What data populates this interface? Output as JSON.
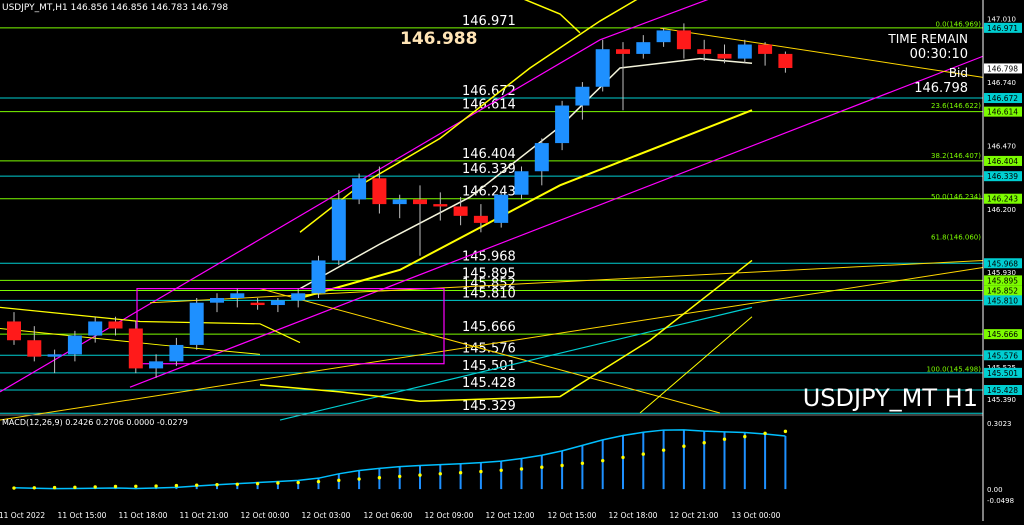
{
  "header": {
    "symbol_tf": "USDJPY_MT,H1",
    "ohlc": "146.856 146.856 146.783 146.798"
  },
  "overlay": {
    "current_price_big": "146.988",
    "time_remain_label": "TIME REMAIN",
    "time_remain_value": "00:30:10",
    "bid_label": "Bid",
    "bid_value": "146.798",
    "watermark": "USDJPY_MT H1"
  },
  "colors": {
    "background": "#000000",
    "bull": "#1e90ff",
    "bear": "#ff1a1a",
    "level_green": "#7cfc00",
    "level_cyan": "#00ced1",
    "magenta": "#ff00ff",
    "yellow": "#ffff00",
    "axis_text": "#ffffff",
    "macd_line": "#00bfff",
    "macd_signal": "#ffff00",
    "macd_hist": "#1e90ff"
  },
  "chart_data": {
    "type": "candlestick",
    "timeframe": "H1",
    "symbol": "USDJPY_MT",
    "ylim": [
      145.33,
      147.03
    ],
    "y_ticks": [
      "147.010",
      "146.740",
      "146.470",
      "146.200",
      "145.930",
      "145.525",
      "145.390"
    ],
    "price_tags": [
      {
        "value": "146.971",
        "color": "#00ced1"
      },
      {
        "value": "146.798",
        "color": "#ffffff"
      },
      {
        "value": "146.672",
        "color": "#00ced1"
      },
      {
        "value": "146.614",
        "color": "#7cfc00"
      },
      {
        "value": "146.404",
        "color": "#7cfc00"
      },
      {
        "value": "146.339",
        "color": "#00ced1"
      },
      {
        "value": "146.243",
        "color": "#7cfc00"
      },
      {
        "value": "145.968",
        "color": "#00ced1"
      },
      {
        "value": "145.895",
        "color": "#7cfc00"
      },
      {
        "value": "145.852",
        "color": "#7cfc00"
      },
      {
        "value": "145.810",
        "color": "#00ced1"
      },
      {
        "value": "145.666",
        "color": "#7cfc00"
      },
      {
        "value": "145.576",
        "color": "#00ced1"
      },
      {
        "value": "145.501",
        "color": "#00ced1"
      },
      {
        "value": "145.428",
        "color": "#00ced1"
      }
    ],
    "levels": [
      {
        "value": 146.971,
        "label": "146.971",
        "color": "#7cfc00"
      },
      {
        "value": 146.672,
        "label": "146.672",
        "color": "#00ced1"
      },
      {
        "value": 146.614,
        "label": "146.614",
        "color": "#7cfc00"
      },
      {
        "value": 146.404,
        "label": "146.404",
        "color": "#7cfc00"
      },
      {
        "value": 146.339,
        "label": "146.339",
        "color": "#00ced1"
      },
      {
        "value": 146.243,
        "label": "146.243",
        "color": "#7cfc00"
      },
      {
        "value": 145.968,
        "label": "145.968",
        "color": "#00ced1"
      },
      {
        "value": 145.895,
        "label": "145.895",
        "color": "#7cfc00"
      },
      {
        "value": 145.852,
        "label": "145.852",
        "color": "#7cfc00"
      },
      {
        "value": 145.81,
        "label": "145.810",
        "color": "#00ced1"
      },
      {
        "value": 145.666,
        "label": "145.666",
        "color": "#7cfc00"
      },
      {
        "value": 145.576,
        "label": "145.576",
        "color": "#00ced1"
      },
      {
        "value": 145.501,
        "label": "145.501",
        "color": "#00ced1"
      },
      {
        "value": 145.428,
        "label": "145.428",
        "color": "#00ced1"
      },
      {
        "value": 145.329,
        "label": "145.329",
        "color": "#00ced1"
      }
    ],
    "fibonacci": [
      {
        "value": 146.969,
        "label": "0.0(146.969)"
      },
      {
        "value": 146.622,
        "label": "23.6(146.622)"
      },
      {
        "value": 146.407,
        "label": "38.2(146.407)"
      },
      {
        "value": 146.234,
        "label": "50.0(146.234)"
      },
      {
        "value": 146.06,
        "label": "61.8(146.060)"
      },
      {
        "value": 145.498,
        "label": "100.0(145.498)"
      }
    ],
    "x_ticks": [
      "11 Oct 2022",
      "11 Oct 15:00",
      "11 Oct 18:00",
      "11 Oct 21:00",
      "12 Oct 00:00",
      "12 Oct 03:00",
      "12 Oct 06:00",
      "12 Oct 09:00",
      "12 Oct 12:00",
      "12 Oct 15:00",
      "12 Oct 18:00",
      "12 Oct 21:00",
      "13 Oct 00:00"
    ],
    "candles": [
      [
        145.72,
        145.76,
        145.62,
        145.64
      ],
      [
        145.64,
        145.7,
        145.55,
        145.57
      ],
      [
        145.57,
        145.6,
        145.5,
        145.58
      ],
      [
        145.58,
        145.68,
        145.55,
        145.66
      ],
      [
        145.66,
        145.74,
        145.63,
        145.72
      ],
      [
        145.72,
        145.74,
        145.66,
        145.69
      ],
      [
        145.69,
        145.72,
        145.5,
        145.52
      ],
      [
        145.52,
        145.58,
        145.48,
        145.55
      ],
      [
        145.55,
        145.65,
        145.53,
        145.62
      ],
      [
        145.62,
        145.82,
        145.6,
        145.8
      ],
      [
        145.8,
        145.84,
        145.76,
        145.82
      ],
      [
        145.82,
        145.86,
        145.78,
        145.84
      ],
      [
        145.8,
        145.82,
        145.77,
        145.79
      ],
      [
        145.79,
        145.82,
        145.76,
        145.81
      ],
      [
        145.81,
        145.86,
        145.78,
        145.84
      ],
      [
        145.84,
        146.0,
        145.82,
        145.98
      ],
      [
        145.98,
        146.28,
        145.96,
        146.24
      ],
      [
        146.24,
        146.35,
        146.22,
        146.33
      ],
      [
        146.33,
        146.38,
        146.18,
        146.22
      ],
      [
        146.22,
        146.26,
        146.16,
        146.24
      ],
      [
        146.24,
        146.3,
        146.0,
        146.22
      ],
      [
        146.22,
        146.27,
        146.15,
        146.21
      ],
      [
        146.21,
        146.25,
        146.13,
        146.17
      ],
      [
        146.17,
        146.22,
        146.1,
        146.14
      ],
      [
        146.14,
        146.28,
        146.12,
        146.26
      ],
      [
        146.26,
        146.38,
        146.24,
        146.36
      ],
      [
        146.36,
        146.5,
        146.3,
        146.48
      ],
      [
        146.48,
        146.66,
        146.45,
        146.64
      ],
      [
        146.64,
        146.74,
        146.58,
        146.72
      ],
      [
        146.72,
        146.92,
        146.7,
        146.88
      ],
      [
        146.88,
        146.91,
        146.62,
        146.86
      ],
      [
        146.86,
        146.94,
        146.84,
        146.91
      ],
      [
        146.91,
        146.97,
        146.89,
        146.96
      ],
      [
        146.96,
        146.99,
        146.84,
        146.88
      ],
      [
        146.88,
        146.92,
        146.83,
        146.86
      ],
      [
        146.86,
        146.9,
        146.82,
        146.84
      ],
      [
        146.84,
        146.92,
        146.82,
        146.9
      ],
      [
        146.9,
        146.91,
        146.81,
        146.86
      ],
      [
        146.86,
        146.87,
        146.78,
        146.8
      ]
    ],
    "macd": {
      "label": "MACD(12,26,9) 0.2426 0.2706 0.0000 -0.0279",
      "ylim": [
        -0.0498,
        0.3023
      ],
      "y_ticks": [
        "0.3023",
        "0.00",
        "-0.0498"
      ],
      "main": [
        0.006,
        0.004,
        0.002,
        0.003,
        0.004,
        0.005,
        0.003,
        0.005,
        0.008,
        0.014,
        0.02,
        0.025,
        0.03,
        0.035,
        0.04,
        0.05,
        0.07,
        0.085,
        0.095,
        0.103,
        0.108,
        0.112,
        0.116,
        0.121,
        0.128,
        0.14,
        0.155,
        0.175,
        0.2,
        0.225,
        0.245,
        0.26,
        0.27,
        0.271,
        0.265,
        0.262,
        0.259,
        0.252,
        0.243
      ],
      "signal": [
        0.005,
        0.006,
        0.007,
        0.008,
        0.01,
        0.012,
        0.013,
        0.014,
        0.016,
        0.018,
        0.02,
        0.022,
        0.025,
        0.028,
        0.03,
        0.034,
        0.04,
        0.046,
        0.052,
        0.058,
        0.064,
        0.07,
        0.075,
        0.08,
        0.086,
        0.092,
        0.1,
        0.108,
        0.118,
        0.13,
        0.145,
        0.16,
        0.178,
        0.196,
        0.212,
        0.228,
        0.24,
        0.255,
        0.264
      ]
    },
    "legend": "none",
    "grid": false
  }
}
